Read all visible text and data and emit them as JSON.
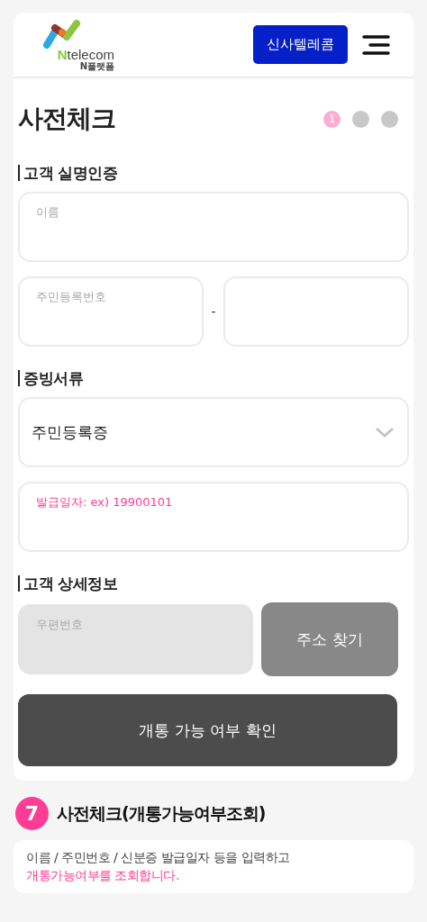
{
  "header": {
    "logo": {
      "letter": "N",
      "rest": "telecom",
      "sub": "N플랫폼"
    },
    "partner_button": "신사텔레콤"
  },
  "form": {
    "title": "사전체크",
    "steps": [
      {
        "label": "1",
        "selected": true
      },
      {
        "selected": false
      },
      {
        "selected": false
      }
    ],
    "sections": [
      {
        "heading": "고객 실명인증"
      },
      {
        "heading": "증빙서류"
      },
      {
        "heading": "고객 상세정보"
      }
    ],
    "name_field": {
      "placeholder": "이름"
    },
    "id_field_front": {
      "placeholder": "주민등록번호"
    },
    "id_separator": "-",
    "document_select": {
      "value": "주민등록증"
    },
    "issue_date_field": {
      "placeholder": "발급일자: ex) 19900101"
    },
    "postal_field": {
      "placeholder": "우편번호",
      "disabled": true
    },
    "address_button": "주소 찾기",
    "submit_button": "개통 가능 여부 확인"
  },
  "note": {
    "number": "7",
    "title": "사전체크(개통가능여부조회)",
    "line_1": "이름 / 주민번호 / 신분증 발급일자 등을 입력하고",
    "line_2": "개통가능여부를 조회합니다."
  }
}
